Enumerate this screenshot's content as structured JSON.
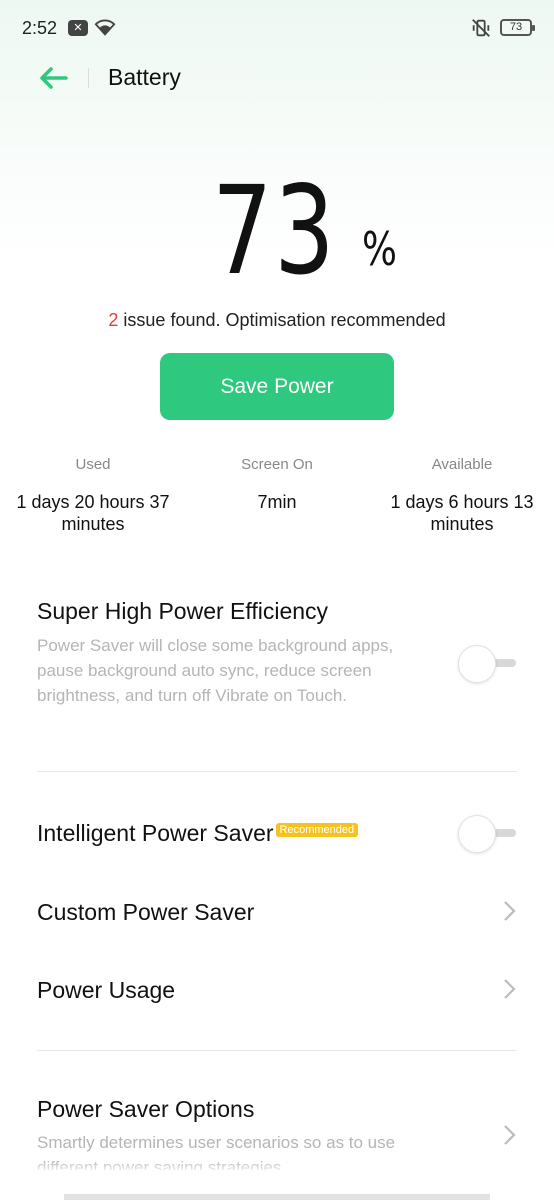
{
  "status_bar": {
    "time": "2:52",
    "battery_level": "73",
    "icons": [
      "notification-icon",
      "wifi-icon",
      "silent-icon",
      "battery-icon"
    ]
  },
  "header": {
    "title": "Battery"
  },
  "battery": {
    "percent": "73",
    "percent_sign": "%",
    "issue_count": "2",
    "issue_text": " issue found. Optimisation recommended"
  },
  "save_button": {
    "label": "Save Power"
  },
  "stats": [
    {
      "label": "Used",
      "value": "1 days 20 hours 37 minutes"
    },
    {
      "label": "Screen On",
      "value": "7min"
    },
    {
      "label": "Available",
      "value": "1 days 6 hours 13 minutes"
    }
  ],
  "settings": {
    "super_high": {
      "title": "Super High Power Efficiency",
      "description": "Power Saver will close some background apps, pause background auto sync, reduce screen brightness, and turn off Vibrate on Touch.",
      "enabled": false
    },
    "intelligent": {
      "title": "Intelligent Power Saver",
      "badge": "Recommended",
      "enabled": false
    },
    "custom": {
      "title": "Custom Power Saver"
    },
    "usage": {
      "title": "Power Usage"
    },
    "options": {
      "title": "Power Saver Options",
      "description": "Smartly determines user scenarios so as to use different power saving strategies."
    }
  },
  "colors": {
    "accent": "#2ec97e",
    "issue_count": "#e0403a",
    "badge": "#f6c21c"
  }
}
